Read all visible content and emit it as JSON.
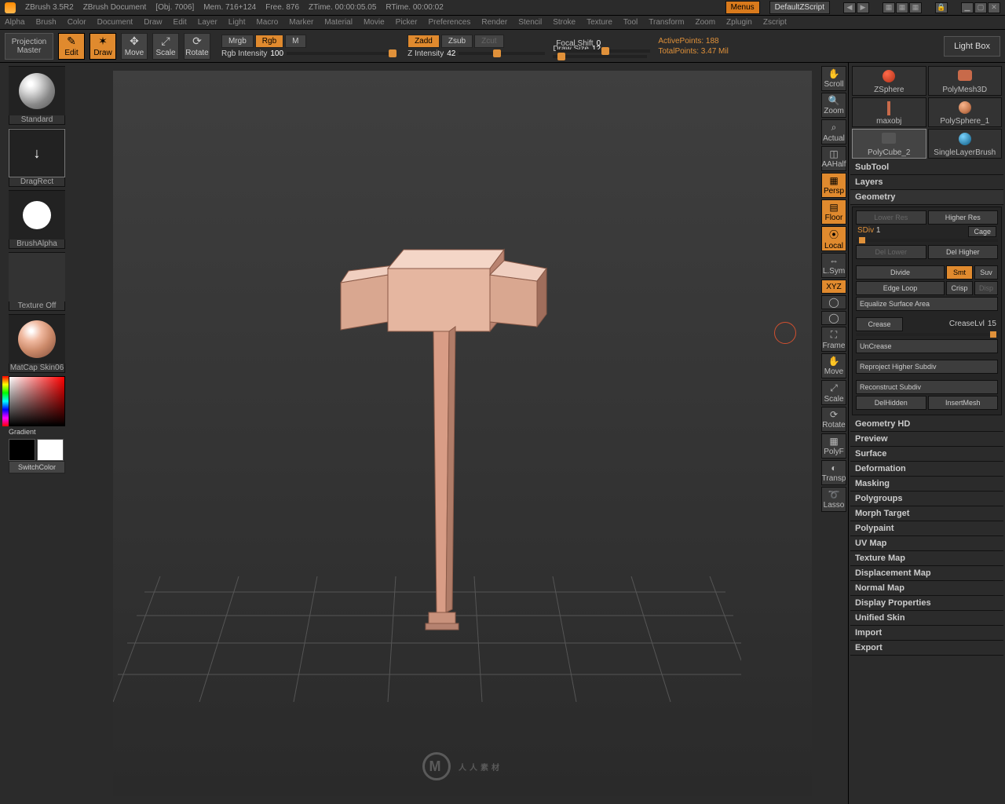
{
  "title": {
    "app": "ZBrush 3.5R2",
    "doc": "ZBrush Document",
    "obj": "[Obj. 7006]",
    "mem": "Mem. 716+124",
    "free": "Free. 876",
    "ztime": "ZTime. 00:00:05.05",
    "rtime": "RTime. 00:00:02",
    "menus": "Menus",
    "defscript": "DefaultZScript"
  },
  "menu": [
    "Alpha",
    "Brush",
    "Color",
    "Document",
    "Draw",
    "Edit",
    "Layer",
    "Light",
    "Macro",
    "Marker",
    "Material",
    "Movie",
    "Picker",
    "Preferences",
    "Render",
    "Stencil",
    "Stroke",
    "Texture",
    "Tool",
    "Transform",
    "Zoom",
    "Zplugin",
    "Zscript"
  ],
  "shelf": {
    "projection1": "Projection",
    "projection2": "Master",
    "edit": "Edit",
    "draw": "Draw",
    "move": "Move",
    "scale": "Scale",
    "rotate": "Rotate",
    "mrgb": "Mrgb",
    "rgb": "Rgb",
    "m": "M",
    "zadd": "Zadd",
    "zsub": "Zsub",
    "zcut": "Zcut",
    "focal_label": "Focal Shift",
    "focal_val": "0",
    "rgbint_label": "Rgb Intensity",
    "rgbint_val": "100",
    "zint_label": "Z Intensity",
    "zint_val": "42",
    "draw_label": "Draw Size",
    "draw_val": "12",
    "active": "ActivePoints: 188",
    "total": "TotalPoints: 3.47 Mil",
    "lightbox": "Light Box"
  },
  "left": {
    "standard": "Standard",
    "dragrect": "DragRect",
    "brushalpha": "BrushAlpha",
    "textureoff": "Texture Off",
    "material": "MatCap Skin06",
    "gradient": "Gradient",
    "switchcolor": "SwitchColor"
  },
  "nav": [
    "Scroll",
    "Zoom",
    "Actual",
    "AAHalf",
    "Persp",
    "Floor",
    "Local",
    "L.Sym",
    "XYZ",
    "",
    "",
    "Frame",
    "Move",
    "Scale",
    "Rotate",
    "PolyF",
    "Transp",
    "Lasso"
  ],
  "tools": {
    "items": [
      "ZSphere",
      "PolyMesh3D",
      "maxobj",
      "PolySphere_1",
      "PolyCube_2",
      "SingleLayerBrush"
    ],
    "subtool": "SubTool",
    "layers": "Layers",
    "geometry": "Geometry",
    "lowerres": "Lower Res",
    "higherres": "Higher Res",
    "sdiv_label": "SDiv",
    "sdiv_val": "1",
    "cage": "Cage",
    "dellower": "Del Lower",
    "delhigher": "Del Higher",
    "divide": "Divide",
    "smt": "Smt",
    "suv": "Suv",
    "edgeloop": "Edge Loop",
    "crisp": "Crisp",
    "disp": "Disp",
    "equalize": "Equalize Surface Area",
    "crease": "Crease",
    "creaselvl_label": "CreaseLvl",
    "creaselvl_val": "15",
    "uncrease": "UnCrease",
    "reproject": "Reproject Higher Subdiv",
    "reconstruct": "Reconstruct Subdiv",
    "delhidden": "DelHidden",
    "insertmesh": "InsertMesh",
    "sections": [
      "Geometry HD",
      "Preview",
      "Surface",
      "Deformation",
      "Masking",
      "Polygroups",
      "Morph Target",
      "Polypaint",
      "UV Map",
      "Texture Map",
      "Displacement Map",
      "Normal Map",
      "Display Properties",
      "Unified Skin",
      "Import",
      "Export"
    ]
  },
  "watermark": "人人素材"
}
